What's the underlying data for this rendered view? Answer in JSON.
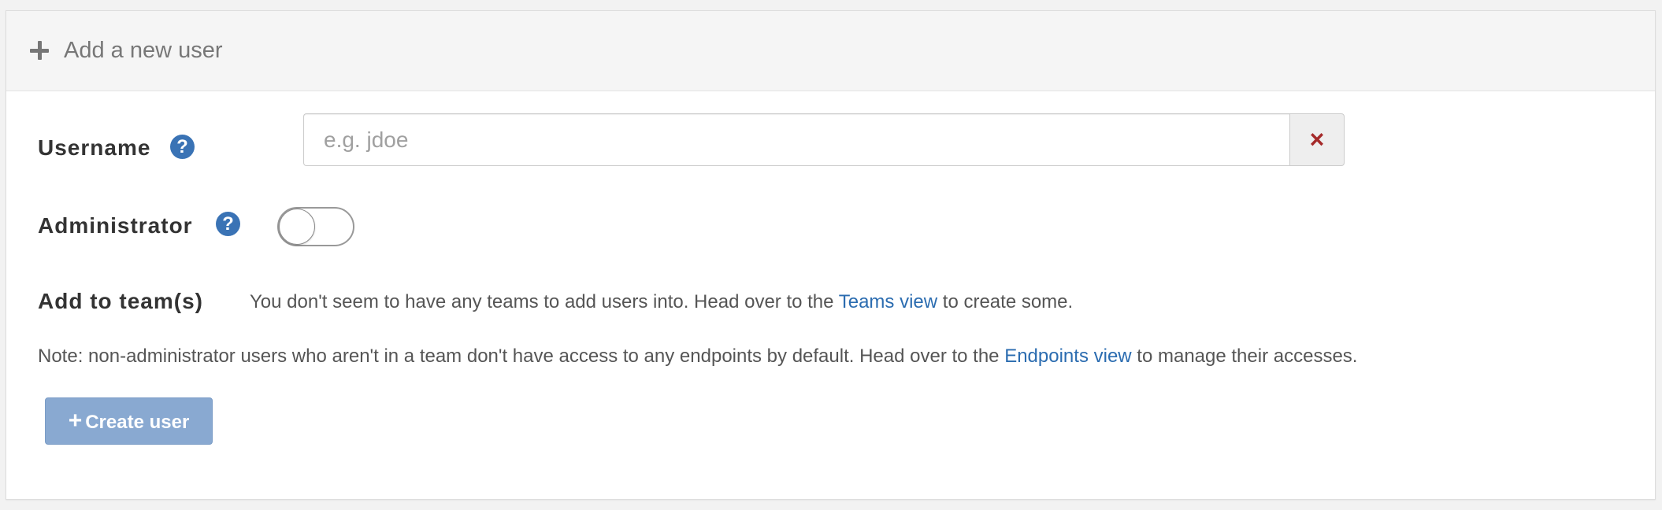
{
  "header": {
    "title": "Add a new user",
    "icon": "plus-icon"
  },
  "form": {
    "username": {
      "label": "Username",
      "placeholder": "e.g. jdoe",
      "value": "",
      "help_icon": "?",
      "clear_icon": "×"
    },
    "administrator": {
      "label": "Administrator",
      "help_icon": "?",
      "checked": false
    },
    "teams": {
      "label": "Add to team(s)",
      "text_before": "You don't seem to have any teams to add users into. Head over to the ",
      "link": "Teams view",
      "text_after": " to create some."
    },
    "note": {
      "text_before": "Note: non-administrator users who aren't in a team don't have access to any endpoints by default. Head over to the ",
      "link": "Endpoints view",
      "text_after": " to manage their accesses."
    },
    "create_button": {
      "icon": "+",
      "label": "Create user"
    }
  },
  "colors": {
    "accent": "#2b6cb0",
    "help_icon": "#3a73b5",
    "clear_icon": "#a52a2a",
    "button_disabled": "#89a9d1"
  }
}
